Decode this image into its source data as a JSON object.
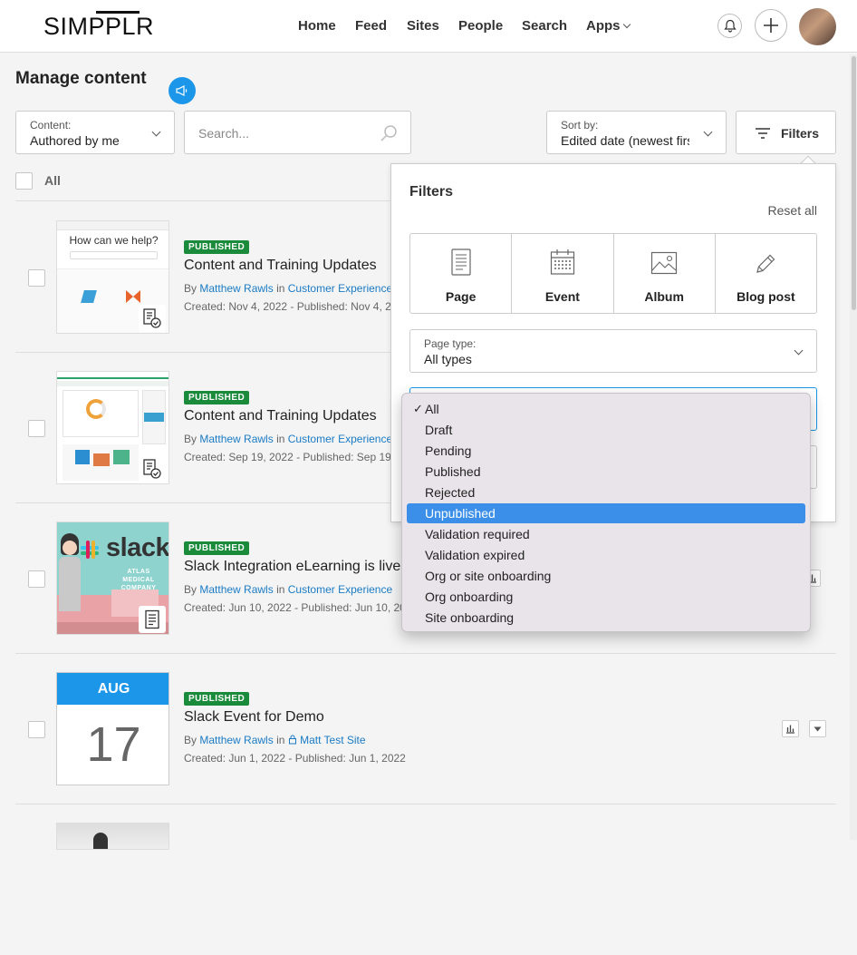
{
  "app": {
    "logo": "SIMPPLR"
  },
  "nav": {
    "home": "Home",
    "feed": "Feed",
    "sites": "Sites",
    "people": "People",
    "search": "Search",
    "apps": "Apps"
  },
  "page": {
    "title": "Manage content"
  },
  "toolbar": {
    "content_label": "Content:",
    "content_value": "Authored by me",
    "search_placeholder": "Search...",
    "sort_label": "Sort by:",
    "sort_value": "Edited date (newest first)",
    "filters_label": "Filters"
  },
  "list": {
    "select_all": "All",
    "rows": [
      {
        "status": "PUBLISHED",
        "title": "Content and Training Updates",
        "by": "By",
        "author": "Matthew Rawls",
        "in": "in",
        "site": "Customer Experience",
        "dates": "Created: Nov 4, 2022 - Published: Nov 4, 2022",
        "thumb_text": "How can we help?"
      },
      {
        "status": "PUBLISHED",
        "title": "Content and Training Updates",
        "by": "By",
        "author": "Matthew Rawls",
        "in": "in",
        "site": "Customer Experience",
        "dates": "Created: Sep 19, 2022 - Published: Sep 19, 2022"
      },
      {
        "status": "PUBLISHED",
        "title": "Slack Integration eLearning is live",
        "by": "By",
        "author": "Matthew Rawls",
        "in": "in",
        "site": "Customer Experience",
        "dates": "Created: Jun 10, 2022 - Published: Jun 10, 2022",
        "thumb_text": "slack",
        "thumb_sub": "ATLAS MEDICAL COMPANY"
      },
      {
        "status": "PUBLISHED",
        "title": "Slack Event for Demo",
        "by": "By",
        "author": "Matthew Rawls",
        "in": "in",
        "site": "Matt Test Site",
        "dates": "Created: Jun 1, 2022 - Published: Jun 1, 2022",
        "month": "AUG",
        "day": "17"
      }
    ]
  },
  "filters": {
    "title": "Filters",
    "reset": "Reset all",
    "types": [
      {
        "label": "Page",
        "icon": "page-icon"
      },
      {
        "label": "Event",
        "icon": "calendar-icon"
      },
      {
        "label": "Album",
        "icon": "image-icon"
      },
      {
        "label": "Blog post",
        "icon": "pencil-icon"
      }
    ],
    "page_type_label": "Page type:",
    "page_type_value": "All types"
  },
  "status_dropdown": {
    "checked": "All",
    "selected": "Unpublished",
    "options": [
      "All",
      "Draft",
      "Pending",
      "Published",
      "Rejected",
      "Unpublished",
      "Validation required",
      "Validation expired",
      "Org or site onboarding",
      "Org onboarding",
      "Site onboarding"
    ]
  },
  "colors": {
    "accent": "#1c96e8",
    "link": "#1a7bc4",
    "published": "#1a8a3b",
    "selected_option": "#3b8fe8",
    "event_header": "#1c96e8"
  }
}
